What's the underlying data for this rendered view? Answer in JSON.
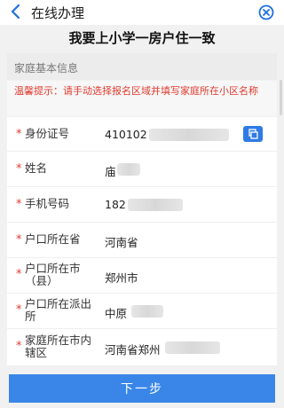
{
  "header": {
    "title": "在线办理",
    "page_title": "我要上小学一房户住一致"
  },
  "section": {
    "title": "家庭基本信息",
    "notice": "温馨提示：请手动选择报名区域并填写家庭所在小区名称"
  },
  "fields": [
    {
      "label": "身份证号",
      "value": "410102",
      "required": "*"
    },
    {
      "label": "姓名",
      "value": "庙",
      "required": "*"
    },
    {
      "label": "手机号码",
      "value": "182",
      "required": "*"
    },
    {
      "label": "户口所在省",
      "value": "河南省",
      "required": "*"
    },
    {
      "label": "户口所在市（县）",
      "value": "郑州市",
      "required": "*"
    },
    {
      "label": "户口所在派出所",
      "value": "中原",
      "required": "*"
    },
    {
      "label": "家庭所在市内辖区",
      "value": "河南省郑州",
      "required": "*"
    }
  ],
  "footer": {
    "next_label": "下一步"
  },
  "colors": {
    "accent": "#3a86e8",
    "notice": "#e03a2e"
  },
  "icons": {
    "back": "back-arrow-icon",
    "close": "close-icon",
    "copy": "copy-icon"
  }
}
